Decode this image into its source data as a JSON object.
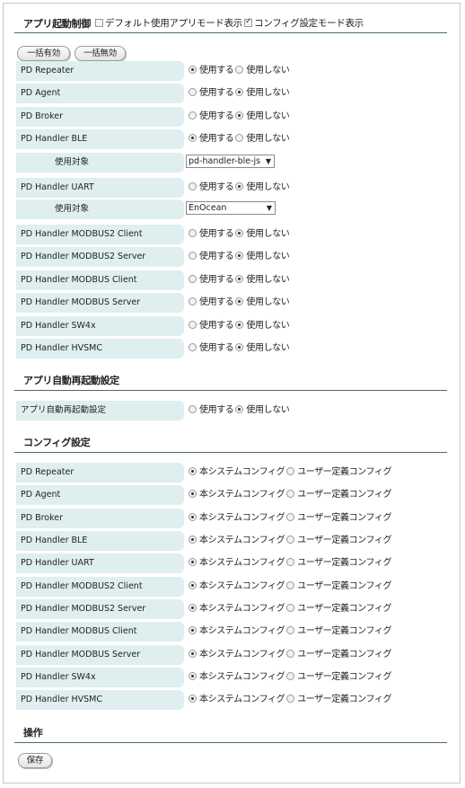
{
  "startup": {
    "title": "アプリ起動制御",
    "default_mode": {
      "label": "デフォルト使用アプリモード表示",
      "checked": false
    },
    "config_mode": {
      "label": "コンフィグ設定モード表示",
      "checked": true
    },
    "enable_all": "一括有効",
    "disable_all": "一括無効",
    "use_label": "使用する",
    "nouse_label": "使用しない",
    "target_label": "使用対象",
    "rows": [
      {
        "name": "PD Repeater",
        "selected": "use"
      },
      {
        "name": "PD Agent",
        "selected": "nouse"
      },
      {
        "name": "PD Broker",
        "selected": "nouse"
      },
      {
        "name": "PD Handler BLE",
        "selected": "use",
        "target": "pd-handler-ble-js"
      },
      {
        "name": "PD Handler UART",
        "selected": "nouse",
        "target": "EnOcean"
      },
      {
        "name": "PD Handler MODBUS2 Client",
        "selected": "nouse"
      },
      {
        "name": "PD Handler MODBUS2 Server",
        "selected": "nouse"
      },
      {
        "name": "PD Handler MODBUS Client",
        "selected": "nouse"
      },
      {
        "name": "PD Handler MODBUS Server",
        "selected": "nouse"
      },
      {
        "name": "PD Handler SW4x",
        "selected": "nouse"
      },
      {
        "name": "PD Handler HVSMC",
        "selected": "nouse"
      }
    ]
  },
  "restart": {
    "title": "アプリ自動再起動設定",
    "row": {
      "name": "アプリ自動再起動設定",
      "selected": "nouse"
    }
  },
  "config": {
    "title": "コンフィグ設定",
    "system_label": "本システムコンフィグ",
    "user_label": "ユーザー定義コンフィグ",
    "rows": [
      {
        "name": "PD Repeater",
        "selected": "system"
      },
      {
        "name": "PD Agent",
        "selected": "system"
      },
      {
        "name": "PD Broker",
        "selected": "system"
      },
      {
        "name": "PD Handler BLE",
        "selected": "system"
      },
      {
        "name": "PD Handler UART",
        "selected": "system"
      },
      {
        "name": "PD Handler MODBUS2 Client",
        "selected": "system"
      },
      {
        "name": "PD Handler MODBUS2 Server",
        "selected": "system"
      },
      {
        "name": "PD Handler MODBUS Client",
        "selected": "system"
      },
      {
        "name": "PD Handler MODBUS Server",
        "selected": "system"
      },
      {
        "name": "PD Handler SW4x",
        "selected": "system"
      },
      {
        "name": "PD Handler HVSMC",
        "selected": "system"
      }
    ]
  },
  "operation": {
    "title": "操作",
    "save": "保存"
  },
  "icons": {
    "select_arrow": "dropdown-arrow-icon",
    "arrow_glyph": "▼"
  }
}
